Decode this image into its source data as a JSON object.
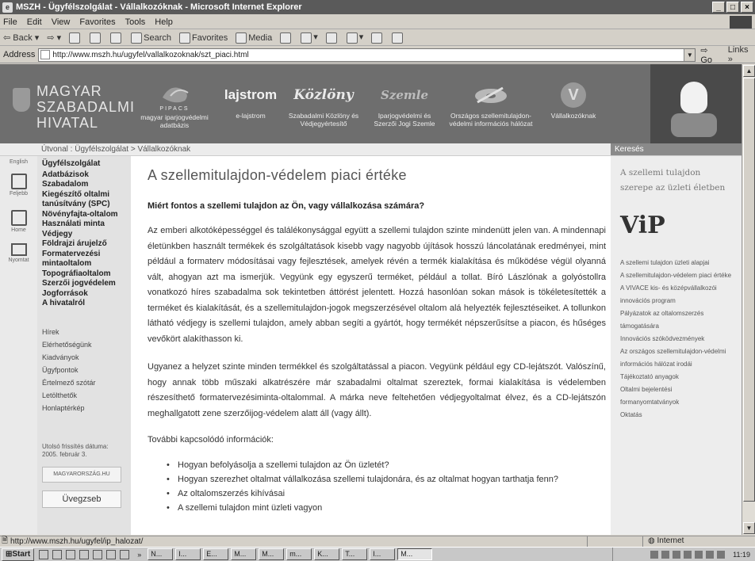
{
  "window": {
    "title": "MSZH - Ügyfélszolgálat - Vállalkozóknak - Microsoft Internet Explorer",
    "menu": [
      "File",
      "Edit",
      "View",
      "Favorites",
      "Tools",
      "Help"
    ]
  },
  "toolbar": {
    "back": "Back",
    "search": "Search",
    "favorites": "Favorites",
    "media": "Media"
  },
  "address": {
    "label": "Address",
    "url": "http://www.mszh.hu/ugyfel/vallalkozoknak/szt_piaci.html",
    "go": "Go",
    "links": "Links"
  },
  "banner": {
    "logo_lines": [
      "MAGYAR",
      "SZABADALMI",
      "HIVATAL"
    ],
    "nav": [
      {
        "name": "nav-pipacs",
        "title": "PIPACS",
        "caption": "magyar iparjogvédelmi adatbázis",
        "icon": "pipacs-logo"
      },
      {
        "name": "nav-lajstrom",
        "title": "lajstrom",
        "caption": "e-lajstrom",
        "icon": "lajstrom-logo"
      },
      {
        "name": "nav-kozlony",
        "title": "Közlöny",
        "caption": "Szabadalmi Közlöny és Védjegyértesítő",
        "icon": "kozlony-logo"
      },
      {
        "name": "nav-szemle",
        "title": "Szemle",
        "caption": "Iparjogvédelmi és Szerzői Jogi Szemle",
        "icon": "szemle-logo"
      },
      {
        "name": "nav-szellemi",
        "title": "",
        "caption": "Országos szellemitulajdon-védelmi információs hálózat",
        "icon": "disc-logo"
      },
      {
        "name": "nav-vallalkozoknak",
        "title": "V",
        "caption": "Vállalkozóknak",
        "icon": "v-logo"
      }
    ]
  },
  "breadcrumb": {
    "text": "Útvonal : Ügyfélszolgálat > Vállalkozóknak",
    "search_label": "Keresés"
  },
  "icon_strip": [
    {
      "label": "English",
      "icon": "flag-icon"
    },
    {
      "label": "Feljebb",
      "icon": "up-icon"
    },
    {
      "label": "Home",
      "icon": "home-icon"
    },
    {
      "label": "Nyomtat",
      "icon": "print-icon"
    }
  ],
  "left_nav": {
    "main": [
      "Ügyfélszolgálat",
      "Adatbázisok",
      "Szabadalom",
      "Kiegészítő oltalmi tanúsítvány (SPC)",
      "Növényfajta-oltalom",
      "Használati minta",
      "Védjegy",
      "Földrajzi árujelző",
      "Formatervezési mintaoltalom",
      "Topográfiaoltalom",
      "Szerzői jogvédelem",
      "Jogforrások",
      "A hivatalról"
    ],
    "secondary": [
      "Hírek",
      "Elérhetőségünk",
      "Kiadványok",
      "Ügyfpontok",
      "Értelmező szótár",
      "Letölthetők",
      "Honlaptérkép"
    ],
    "updated": "Utolsó frissítés dátuma: 2005. február 3.",
    "badge": "MAGYARORSZÁG.HU",
    "glass_label": "Üvegzseb"
  },
  "content": {
    "title": "A szellemitulajdon-védelem piaci értéke",
    "subtitle": "Miért fontos a szellemi tulajdon az Ön, vagy vállalkozása számára?",
    "paragraphs": [
      "Az emberi alkotóképességgel és találékonysággal együtt a szellemi tulajdon szinte mindenütt jelen van. A mindennapi életünkben használt termékek és szolgáltatások kisebb vagy nagyobb újítások hosszú láncolatának eredményei, mint például a formaterv módosításai vagy fejlesztések, amelyek révén a termék kialakítása és működése végül olyanná vált, ahogyan azt ma ismerjük. Vegyünk egy egyszerű terméket, például a tollat. Bíró Lászlónak a golyóstollra vonatkozó híres szabadalma sok tekintetben áttörést jelentett. Hozzá hasonlóan sokan mások is tökéletesítették a terméket és kialakítását, és a szellemitulajdon-jogok megszerzésével oltalom alá helyezték fejlesztéseiket. A tollunkon látható védjegy is szellemi tulajdon, amely abban segíti a gyártót, hogy termékét népszerűsítse a piacon, és hűséges vevőkört alakíthasson ki.",
      "Ugyanez a helyzet szinte minden termékkel és szolgáltatással a piacon. Vegyünk például egy CD-lejátszót. Valószínű, hogy annak több műszaki alkatrészére már szabadalmi oltalmat szereztek, formai kialakítása is védelemben részesíthető formatervezésiminta-oltalommal. A márka neve feltehetően védjegyoltalmat élvez, és a CD-lejátszón meghallgatott zene szerzőijog-védelem alatt áll (vagy állt)."
    ],
    "more_label": "További kapcsolódó információk:",
    "links": [
      "Hogyan befolyásolja a szellemi tulajdon az Ön üzletét?",
      "Hogyan szerezhet oltalmat vállalkozása szellemi tulajdonára, és az oltalmat hogyan tarthatja fenn?",
      "Az oltalomszerzés kihívásai",
      "A szellemi tulajdon mint üzleti vagyon"
    ]
  },
  "right_bar": {
    "tagline": "A szellemi tulajdon szerepe az üzleti életben",
    "vip": "ViP",
    "links": [
      "A szellemi tulajdon üzleti alapjai",
      "A szellemitulajdon-védelem piaci értéke",
      "A VIVACE kis- és középvállalkozói innovációs program",
      "Pályázatok az oltalomszerzés támogatására",
      "Innovációs szóködvezmények",
      "Az országos szellemitulajdon-védelmi információs hálózat irodái",
      "Tájékoztató anyagok",
      "Oltalmi bejelentési formanyomtatványok",
      "Oktatás"
    ]
  },
  "status": {
    "url": "http://www.mszh.hu/ugyfel/ip_halozat/",
    "zone": "Internet"
  },
  "taskbar": {
    "start": "Start",
    "tasks": [
      "N...",
      "I...",
      "E...",
      "M...",
      "M...",
      "m...",
      "K...",
      "T...",
      "I...",
      "M..."
    ],
    "clock": "11:19"
  }
}
